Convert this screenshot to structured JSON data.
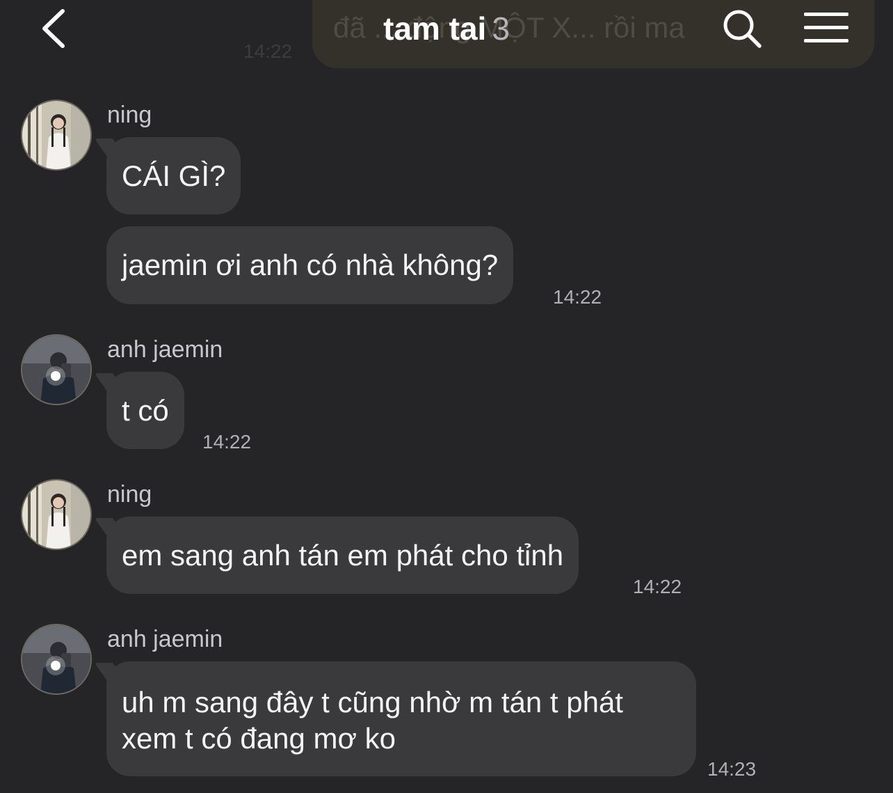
{
  "header": {
    "title": "tam tai",
    "member_count": "3",
    "back_icon": "chevron-left-icon",
    "search_icon": "search-icon",
    "menu_icon": "menu-icon"
  },
  "previous_message": {
    "text": "đã ... động MỘT X... rồi ma",
    "time": "14:22"
  },
  "messages": [
    {
      "sender": "ning",
      "text": "CÁI GÌ?",
      "time": ""
    },
    {
      "sender": "",
      "text": "jaemin ơi anh có nhà không?",
      "time": "14:22"
    },
    {
      "sender": "anh jaemin",
      "text": "t có",
      "time": "14:22"
    },
    {
      "sender": "ning",
      "text": "em sang anh tán em phát cho tỉnh",
      "time": "14:22"
    },
    {
      "sender": "anh jaemin",
      "text": "uh m sang đây t cũng nhờ m tán t phát xem t có đang mơ ko",
      "time": "14:23"
    }
  ],
  "colors": {
    "background": "#252527",
    "incoming_bubble": "#3a3a3c",
    "outgoing_bubble": "#34312b"
  }
}
